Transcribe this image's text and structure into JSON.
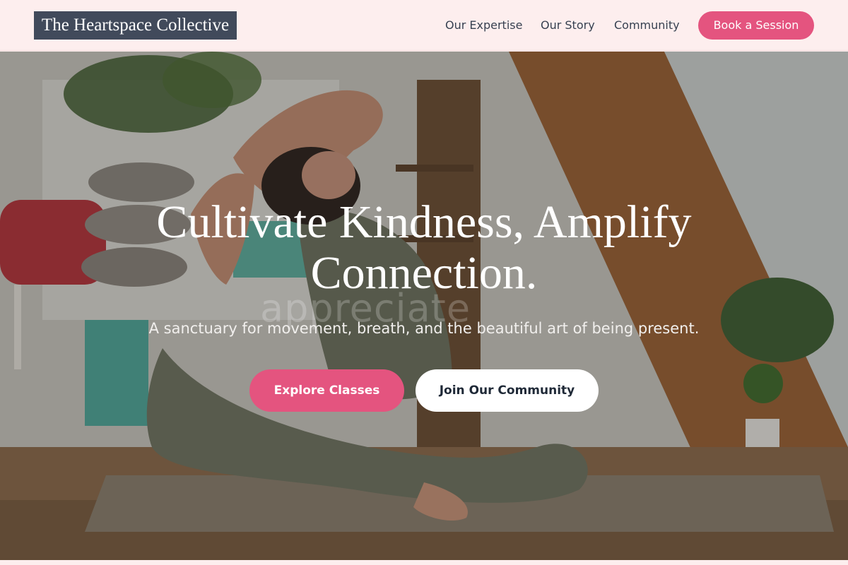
{
  "header": {
    "logo": "The Heartspace Collective",
    "nav": [
      "Our Expertise",
      "Our Story",
      "Community"
    ],
    "cta": "Book a Session"
  },
  "hero": {
    "background_image": "yoga-pose-photo",
    "ghost_text": "appreciate",
    "title": "Cultivate Kindness, Amplify Connection.",
    "subtitle": "A sanctuary for movement, breath, and the beautiful art of being present.",
    "primary_button": "Explore Classes",
    "secondary_button": "Join Our Community"
  },
  "colors": {
    "accent": "#e4547f",
    "header_bg": "#fdeeee",
    "logo_bg": "#414a5b",
    "nav_text": "#374151"
  }
}
